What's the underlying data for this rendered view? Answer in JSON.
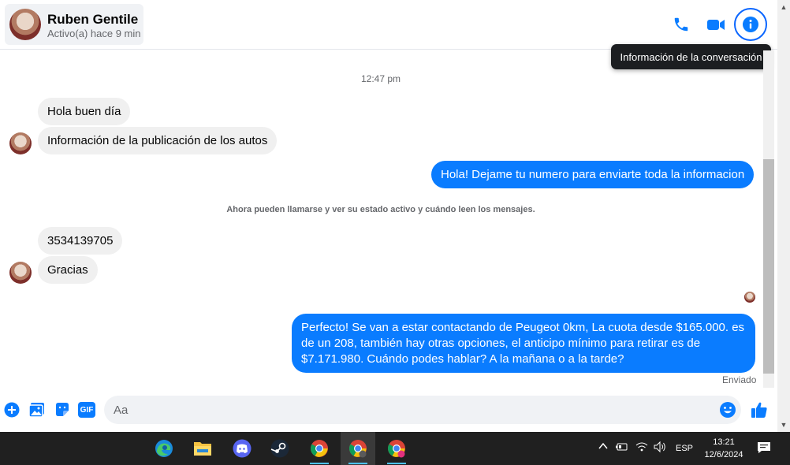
{
  "header": {
    "contact_name": "Ruben Gentile",
    "contact_status": "Activo(a) hace 9 min",
    "tooltip": "Información de la conversación",
    "icons": [
      "phone-icon",
      "video-icon",
      "info-icon"
    ]
  },
  "conversation": {
    "time": "12:47 pm",
    "notice": "Ahora pueden llamarse y ver su estado activo y cuándo leen los mensajes.",
    "messages": [
      {
        "from": "them",
        "text": "Hola buen día"
      },
      {
        "from": "them",
        "text": "Información de la publicación de los autos"
      },
      {
        "from": "me",
        "text": "Hola! Dejame tu numero para enviarte toda la informacion"
      },
      {
        "from": "them",
        "text": "3534139705"
      },
      {
        "from": "them",
        "text": "Gracias"
      },
      {
        "from": "me",
        "lines": [
          "Perfecto!  Se van a estar contactando de Peugeot 0km, La cuota desde $165.000. es",
          "de un 208, también hay otras opciones, el anticipo mínimo para retirar es de",
          "$7.171.980. Cuándo podes hablar? A la mañana o a la tarde?"
        ]
      }
    ],
    "sent_label": "Enviado"
  },
  "composer": {
    "placeholder": "Aa",
    "gif_label": "GIF"
  },
  "taskbar": {
    "apps": [
      "edge-icon",
      "file-explorer-icon",
      "discord-icon",
      "steam-icon",
      "chrome-icon",
      "chrome-icon",
      "chrome-icon"
    ],
    "language": "ESP",
    "time": "13:21",
    "date": "12/6/2024"
  },
  "colors": {
    "accent": "#0a7cff",
    "incoming_bubble": "#f0f0f0",
    "taskbar": "#202020"
  }
}
